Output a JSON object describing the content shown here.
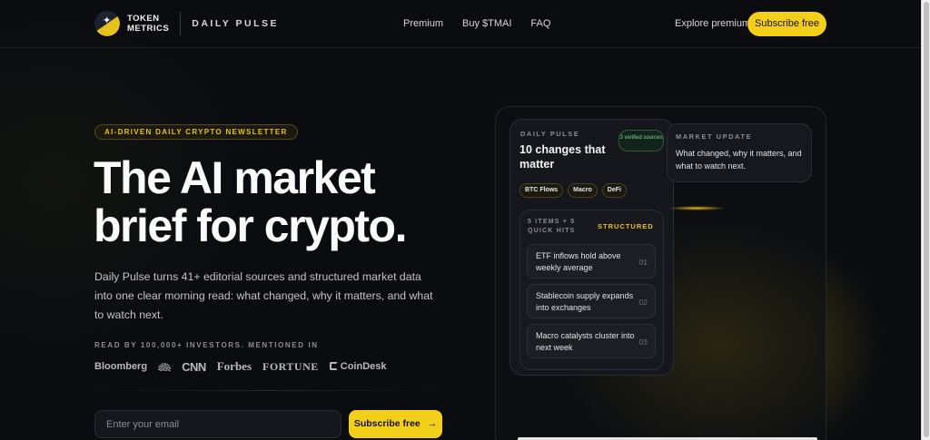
{
  "header": {
    "logo_line1": "TOKEN",
    "logo_line2": "METRICS",
    "product": "DAILY PULSE",
    "nav": [
      "Premium",
      "Buy $TMAI",
      "FAQ"
    ],
    "explore": "Explore premium",
    "subscribe": "Subscribe free"
  },
  "hero": {
    "tagline": "AI-DRIVEN DAILY CRYPTO NEWSLETTER",
    "title_line1": "The AI market",
    "title_line2": "brief for crypto.",
    "subtitle": "Daily Pulse turns 41+ editorial sources and structured market data into one clear morning read: what changed, why it matters, and what to watch next.",
    "read_by": "READ BY 100,000+ INVESTORS. MENTIONED IN",
    "brands": [
      "Bloomberg",
      "CNN",
      "Forbes",
      "FORTUNE",
      "CoinDesk"
    ],
    "email_placeholder": "Enter your email",
    "subscribe": "Subscribe free",
    "subscribe_arrow": "→"
  },
  "card": {
    "label": "DAILY PULSE",
    "title": "10 changes that matter",
    "verified": "3 verified sources",
    "chips": [
      "BTC Flows",
      "Macro",
      "DeFi"
    ],
    "items_label": "5 ITEMS + 5 QUICK HITS",
    "structured": "STRUCTURED",
    "hits": [
      {
        "text": "ETF inflows hold above weekly average",
        "num": "01"
      },
      {
        "text": "Stablecoin supply expands into exchanges",
        "num": "02"
      },
      {
        "text": "Macro catalysts cluster into next week",
        "num": "03"
      }
    ]
  },
  "update": {
    "label": "MARKET UPDATE",
    "text": "What changed, why it matters, and what to watch next."
  },
  "colors": {
    "accent": "#f4cf1a",
    "background": "#0a0c10"
  }
}
